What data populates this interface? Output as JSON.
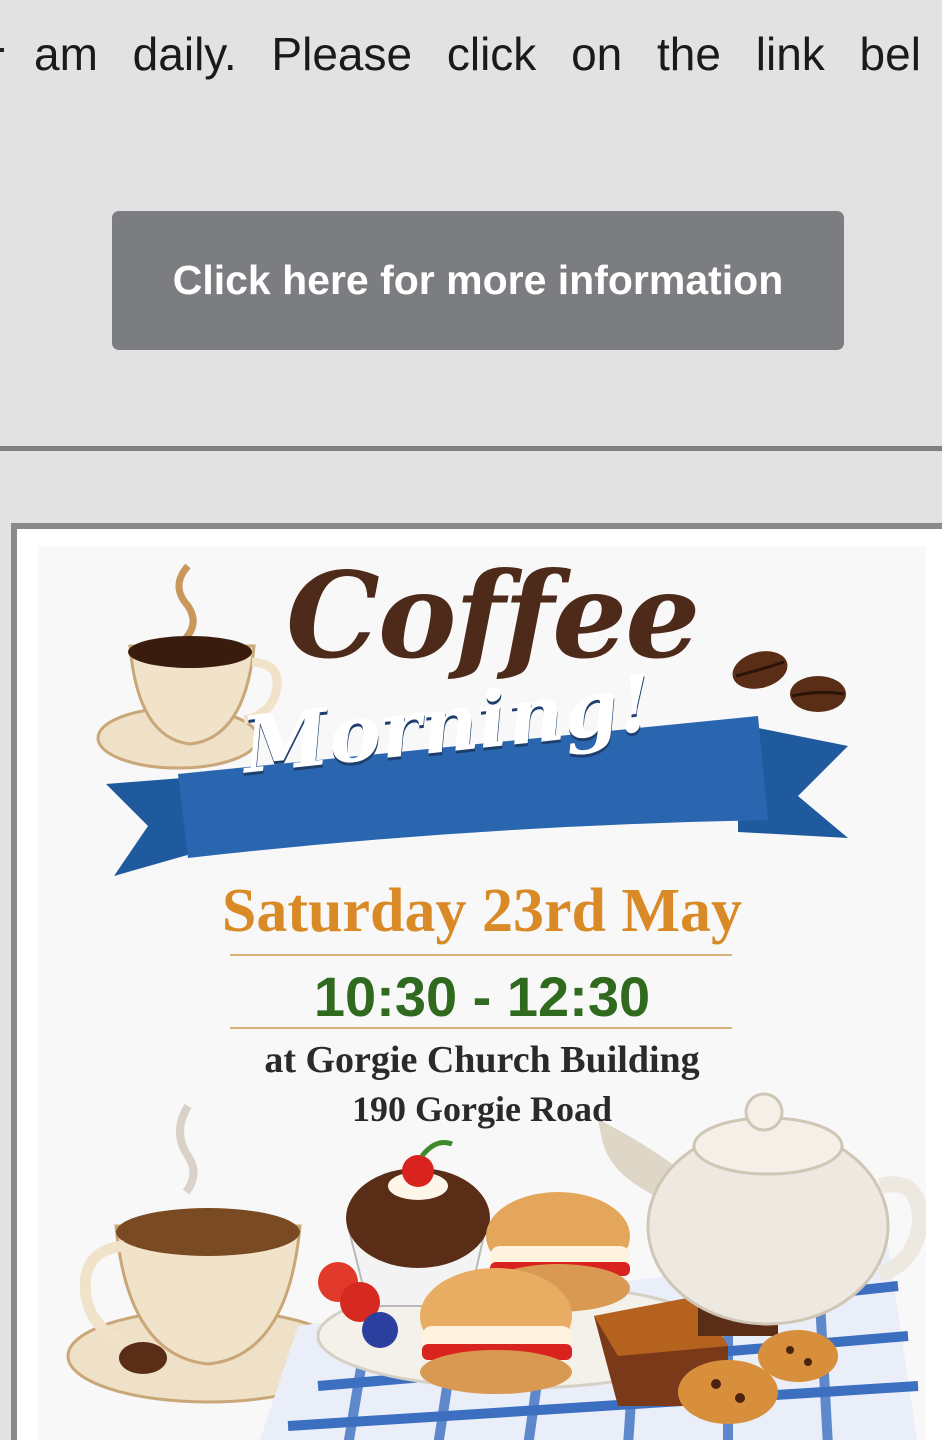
{
  "intro": {
    "text": "am daily. Please click on the link bel"
  },
  "info_button": {
    "label": "Click here for more information"
  },
  "poster": {
    "title_line1": "Coffee",
    "title_line2": "Morning!",
    "date": "Saturday 23rd May",
    "time": "10:30 - 12:30",
    "venue": "at Gorgie Church Building",
    "address": "190 Gorgie Road",
    "colors": {
      "title": "#4e2a1a",
      "ribbon": "#2a66b0",
      "date": "#d98a26",
      "time": "#2f6a1f"
    },
    "icons": [
      "coffee-cup-icon",
      "coffee-bean-icon",
      "teapot-icon",
      "cupcake-icon",
      "scone-icon",
      "cake-slice-icon",
      "cookie-icon"
    ]
  }
}
